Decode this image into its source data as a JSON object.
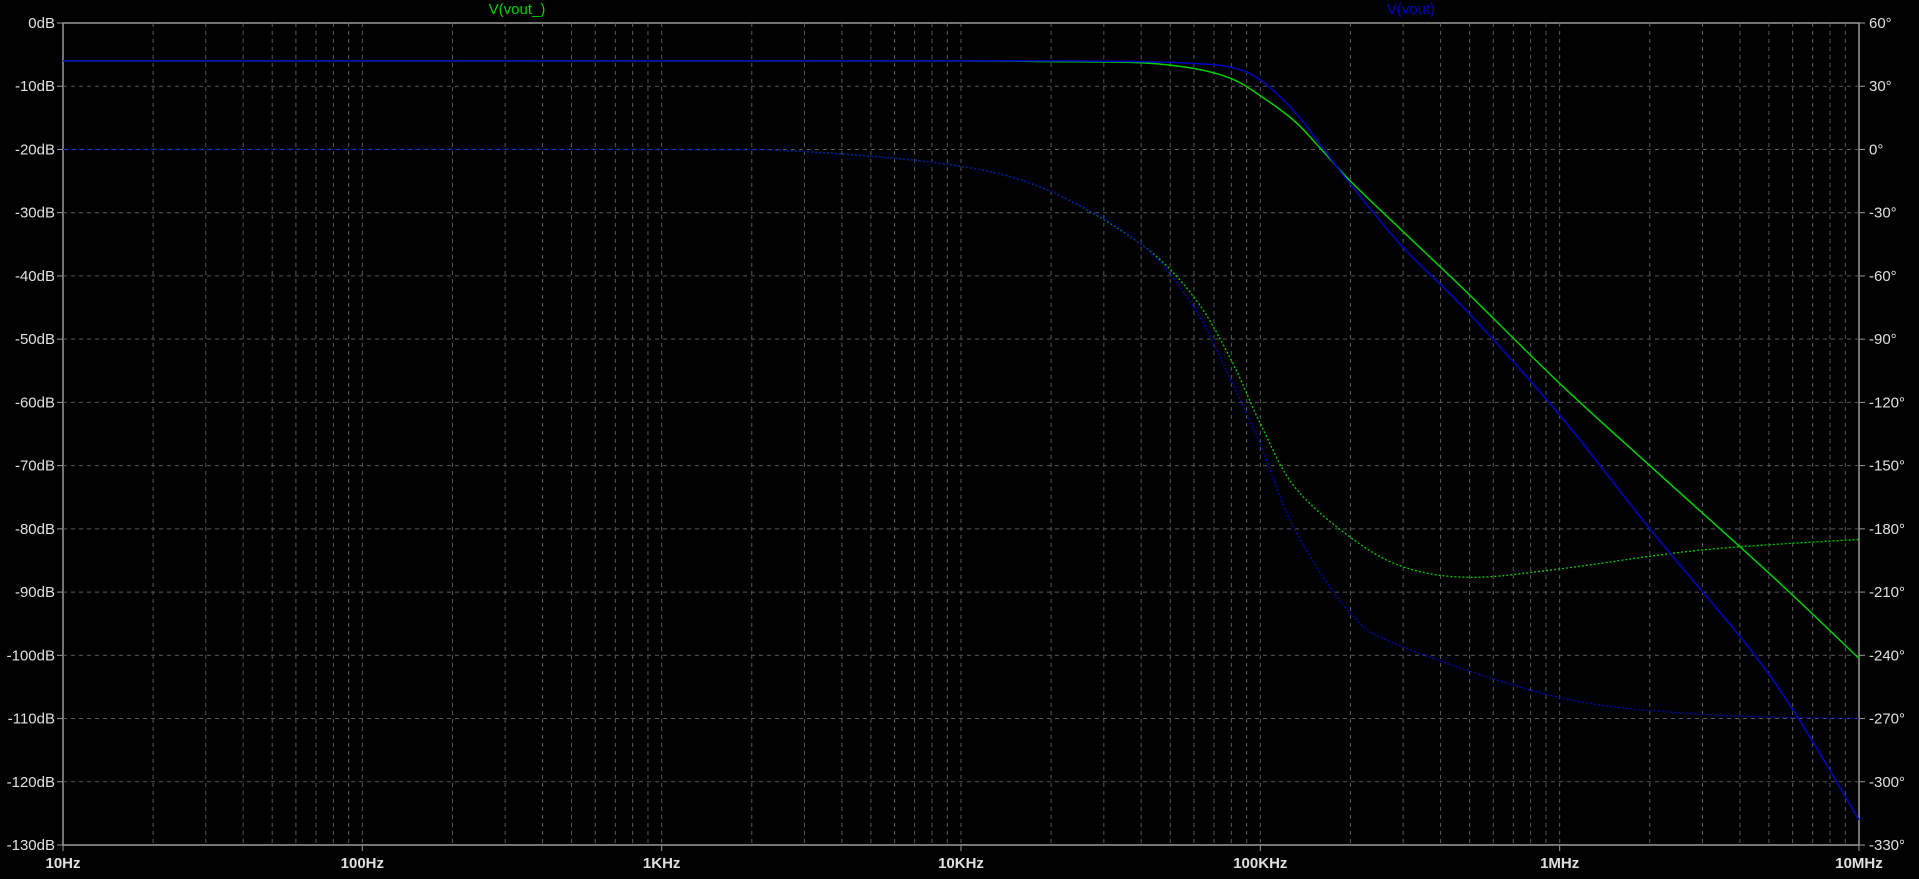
{
  "chart_data": {
    "type": "line",
    "x_scale": "log",
    "x_range_hz": [
      10,
      10000000
    ],
    "left_axis": {
      "unit": "dB",
      "range": [
        -130,
        0
      ],
      "step": 10
    },
    "right_axis": {
      "unit": "°",
      "range": [
        -330,
        60
      ],
      "step": 30
    },
    "x_tick_labels": [
      "10Hz",
      "100Hz",
      "1KHz",
      "10KHz",
      "100KHz",
      "1MHz",
      "10MHz"
    ],
    "y_left_tick_labels": [
      "0dB",
      "-10dB",
      "-20dB",
      "-30dB",
      "-40dB",
      "-50dB",
      "-60dB",
      "-70dB",
      "-80dB",
      "-90dB",
      "-100dB",
      "-110dB",
      "-120dB",
      "-130dB"
    ],
    "y_right_tick_labels": [
      "60°",
      "30°",
      "0°",
      "-30°",
      "-60°",
      "-90°",
      "-120°",
      "-150°",
      "-180°",
      "-210°",
      "-240°",
      "-270°",
      "-300°",
      "-330°"
    ],
    "grid": true,
    "legend": [
      "V(vout_)",
      "V(vout)"
    ],
    "series": [
      {
        "name": "V(vout_)",
        "color": "#00d000",
        "magnitude_db": [
          [
            10,
            -6.0
          ],
          [
            1000,
            -6.0
          ],
          [
            10000,
            -6.0
          ],
          [
            20000,
            -6.1
          ],
          [
            40000,
            -6.3
          ],
          [
            60000,
            -7.2
          ],
          [
            80000,
            -8.8
          ],
          [
            100000,
            -11.5
          ],
          [
            130000,
            -15.5
          ],
          [
            160000,
            -20.0
          ],
          [
            200000,
            -25.0
          ],
          [
            300000,
            -33.0
          ],
          [
            500000,
            -43.0
          ],
          [
            1000000,
            -57.0
          ],
          [
            2000000,
            -70.0
          ],
          [
            5000000,
            -87.0
          ],
          [
            10000000,
            -100.5
          ]
        ],
        "phase_deg": [
          [
            10,
            0
          ],
          [
            1000,
            0
          ],
          [
            3000,
            -1
          ],
          [
            10000,
            -8
          ],
          [
            20000,
            -20
          ],
          [
            40000,
            -45
          ],
          [
            60000,
            -70
          ],
          [
            80000,
            -100
          ],
          [
            100000,
            -130
          ],
          [
            130000,
            -160
          ],
          [
            200000,
            -184
          ],
          [
            300000,
            -198
          ],
          [
            500000,
            -203
          ],
          [
            1000000,
            -199
          ],
          [
            3000000,
            -190
          ],
          [
            10000000,
            -185
          ]
        ]
      },
      {
        "name": "V(vout)",
        "color": "#0000c8",
        "magnitude_db": [
          [
            10,
            -6.0
          ],
          [
            1000,
            -6.0
          ],
          [
            10000,
            -6.0
          ],
          [
            20000,
            -6.0
          ],
          [
            40000,
            -6.1
          ],
          [
            60000,
            -6.4
          ],
          [
            80000,
            -7.0
          ],
          [
            100000,
            -9.0
          ],
          [
            130000,
            -14.0
          ],
          [
            160000,
            -19.5
          ],
          [
            200000,
            -25.5
          ],
          [
            300000,
            -35.5
          ],
          [
            500000,
            -46.0
          ],
          [
            1000000,
            -62.0
          ],
          [
            2000000,
            -80.0
          ],
          [
            5000000,
            -103.0
          ],
          [
            10000000,
            -126.0
          ]
        ],
        "phase_deg": [
          [
            10,
            0
          ],
          [
            1000,
            0
          ],
          [
            3000,
            -1
          ],
          [
            10000,
            -8
          ],
          [
            20000,
            -20
          ],
          [
            40000,
            -45
          ],
          [
            60000,
            -75
          ],
          [
            80000,
            -110
          ],
          [
            100000,
            -140
          ],
          [
            130000,
            -180
          ],
          [
            200000,
            -220
          ],
          [
            300000,
            -236
          ],
          [
            1000000,
            -260
          ],
          [
            3000000,
            -268
          ],
          [
            10000000,
            -270
          ]
        ]
      }
    ]
  }
}
